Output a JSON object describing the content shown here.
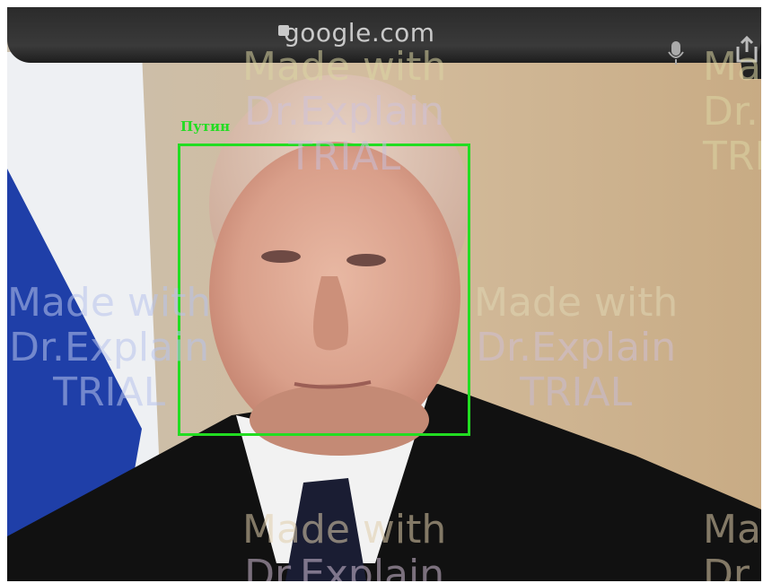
{
  "browser": {
    "url": "google.com",
    "icons": [
      "lock-icon",
      "mic-icon",
      "share-icon"
    ]
  },
  "detection": {
    "label": "Путин",
    "box_color": "#22dd22"
  },
  "watermark": {
    "line1": "Made with",
    "line2": "Dr.Explain",
    "line3": "TRIAL"
  },
  "colors": {
    "flag_blue": "#1f3fa8",
    "suit": "#111111",
    "shirt": "#f2f2f2",
    "wall": "#cdb79a"
  }
}
